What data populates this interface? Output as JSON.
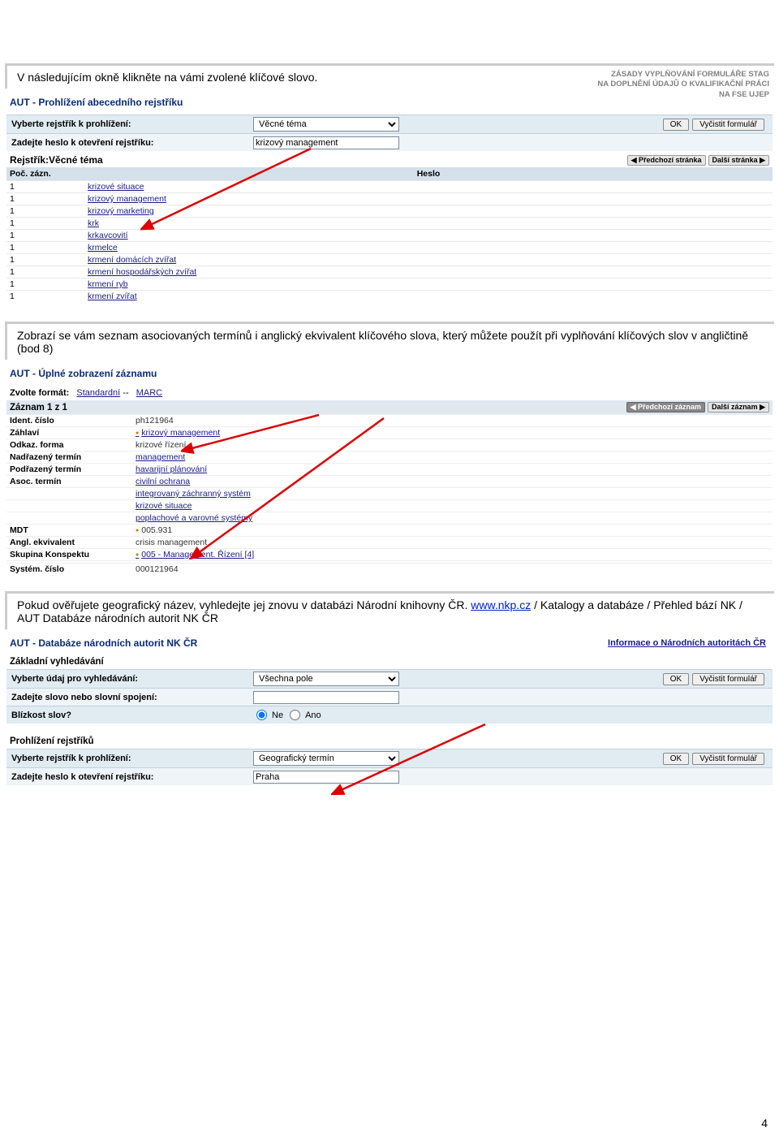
{
  "header": {
    "line1": "ZÁSADY VYPLŇOVÁNÍ FORMULÁŘE STAG",
    "line2": "NA DOPLNĚNÍ ÚDAJŮ O KVALIFIKAČNÍ PRÁCI",
    "line3": "NA FSE UJEP"
  },
  "text1": "V následujícím okně klikněte na vámi zvolené klíčové slovo.",
  "panel1": {
    "title": "AUT - Prohlížení abecedního rejstříku",
    "label_select": "Vyberte rejstřík k prohlížení:",
    "select_value": "Věcné téma",
    "label_input": "Zadejte heslo k otevření rejstříku:",
    "input_value": "krizový management",
    "btn_ok": "OK",
    "btn_clear": "Vyčistit formulář",
    "rejstrik_label": "Rejstřík:",
    "rejstrik_value": " Věcné téma",
    "prev": "◀ Předchozí stránka",
    "next": "Další stránka ▶",
    "col1": "Poč. zázn.",
    "col2": "Heslo",
    "rows": [
      {
        "n": "1",
        "h": "krizové situace"
      },
      {
        "n": "1",
        "h": "krizový management"
      },
      {
        "n": "1",
        "h": "krizový marketing"
      },
      {
        "n": "1",
        "h": "krk"
      },
      {
        "n": "1",
        "h": "krkavcovití"
      },
      {
        "n": "1",
        "h": "krmelce"
      },
      {
        "n": "1",
        "h": "krmení domácích zvířat"
      },
      {
        "n": "1",
        "h": "krmení hospodářských zvířat"
      },
      {
        "n": "1",
        "h": "krmení ryb"
      },
      {
        "n": "1",
        "h": "krmení zvířat"
      }
    ]
  },
  "text2": "Zobrazí se vám seznam asociovaných termínů i anglický ekvivalent klíčového slova, který můžete použít při vyplňování klíčových slov v angličtině (bod 8)",
  "panel2": {
    "title": "AUT - Úplné zobrazení záznamu",
    "format_label": "Zvolte formát:",
    "format1": "Standardní",
    "sep": " -- ",
    "format2": "MARC",
    "zaznam": "Záznam 1 z 1",
    "prev": "◀ Předchozí záznam",
    "next": "Další záznam ▶",
    "rows": [
      {
        "l": "Ident. číslo",
        "v": "ph121964",
        "cls": ""
      },
      {
        "l": "Záhlaví",
        "v": "krizový management",
        "cls": "link bullet"
      },
      {
        "l": "Odkaz. forma",
        "v": "krizové řízení",
        "cls": ""
      },
      {
        "l": "Nadřazený termín",
        "v": "management",
        "cls": "link"
      },
      {
        "l": "Podřazený termín",
        "v": "havarijní plánování",
        "cls": "link"
      },
      {
        "l": "Asoc. termín",
        "v": "civilní ochrana",
        "cls": "link"
      },
      {
        "l": "",
        "v": "integrovaný záchranný systém",
        "cls": "link"
      },
      {
        "l": "",
        "v": "krizové situace",
        "cls": "link"
      },
      {
        "l": "",
        "v": "poplachové a varovné systémy",
        "cls": "link"
      },
      {
        "l": "MDT",
        "v": "005.931",
        "cls": "bullet"
      },
      {
        "l": "Angl. ekvivalent",
        "v": "crisis management",
        "cls": ""
      },
      {
        "l": "Skupina Konspektu",
        "v": "005 - Management. Řízení [4]",
        "cls": "link bullet"
      },
      {
        "l": "",
        "v": "",
        "cls": ""
      },
      {
        "l": "Systém. číslo",
        "v": "000121964",
        "cls": ""
      }
    ]
  },
  "text3a": "Pokud ověřujete geografický název, vyhledejte jej znovu v databázi Národní knihovny ČR. ",
  "text3b": "www.nkp.cz",
  "text3c": " / Katalogy a databáze / Přehled bází NK / AUT Databáze národních autorit NK ČR",
  "panel3": {
    "title": "AUT -  Databáze národních autorit NK ČR",
    "info_link": "Informace o Národních autoritách ČR",
    "sub1": "Základní vyhledávání",
    "label_select": "Vyberte údaj pro vyhledávání:",
    "select_value": "Všechna pole",
    "label_input": "Zadejte slovo nebo slovní spojení:",
    "input_value": "",
    "label_blizkost": "Blízkost slov?",
    "radio_ne": "Ne",
    "radio_ano": "Ano",
    "btn_ok": "OK",
    "btn_clear": "Vyčistit formulář",
    "sub2": "Prohlížení rejstříků",
    "label_select2": "Vyberte rejstřík k prohlížení:",
    "select2_value": "Geografický termín",
    "label_input2": "Zadejte heslo k otevření rejstříku:",
    "input2_value": "Praha"
  },
  "page_num": "4"
}
